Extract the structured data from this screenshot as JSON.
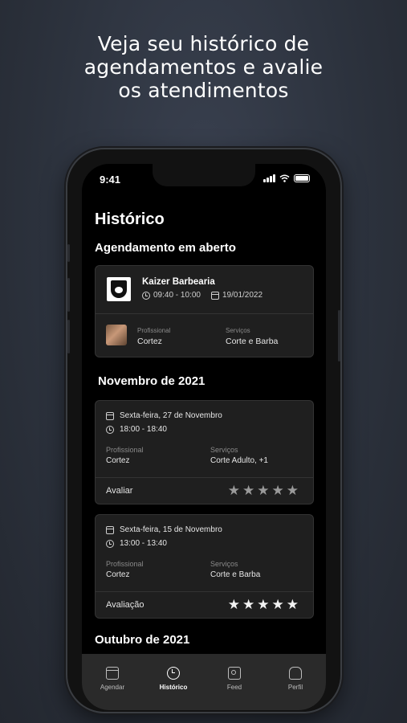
{
  "headline": {
    "line1": "Veja seu histórico de",
    "line2": "agendamentos e avalie",
    "line3": "os atendimentos"
  },
  "status_bar": {
    "time": "9:41",
    "icons": [
      "signal-icon",
      "wifi-icon",
      "battery-icon"
    ]
  },
  "page": {
    "title": "Histórico"
  },
  "open_section": {
    "title": "Agendamento em aberto",
    "card": {
      "shop_name": "Kaizer Barbearia",
      "time": "09:40 - 10:00",
      "date": "19/01/2022",
      "professional_label": "Profissional",
      "professional": "Cortez",
      "services_label": "Serviços",
      "services": "Corte e Barba"
    }
  },
  "november": {
    "title": "Novembro de 2021",
    "items": [
      {
        "date": "Sexta-feira, 27 de Novembro",
        "time": "18:00 - 18:40",
        "professional_label": "Profissional",
        "professional": "Cortez",
        "services_label": "Serviços",
        "services": "Corte Adulto, +1",
        "rating_label": "Avaliar",
        "rating": 0,
        "rating_max": 5
      },
      {
        "date": "Sexta-feira, 15 de Novembro",
        "time": "13:00 - 13:40",
        "professional_label": "Profissional",
        "professional": "Cortez",
        "services_label": "Serviços",
        "services": "Corte e Barba",
        "rating_label": "Avaliação",
        "rating": 5,
        "rating_max": 5
      }
    ]
  },
  "october": {
    "title": "Outubro de 2021"
  },
  "tabbar": {
    "active": "Histórico",
    "tabs": [
      {
        "label": "Agendar",
        "icon": "calendar-icon"
      },
      {
        "label": "Histórico",
        "icon": "history-icon"
      },
      {
        "label": "Feed",
        "icon": "image-icon"
      },
      {
        "label": "Perfil",
        "icon": "profile-icon"
      }
    ]
  }
}
